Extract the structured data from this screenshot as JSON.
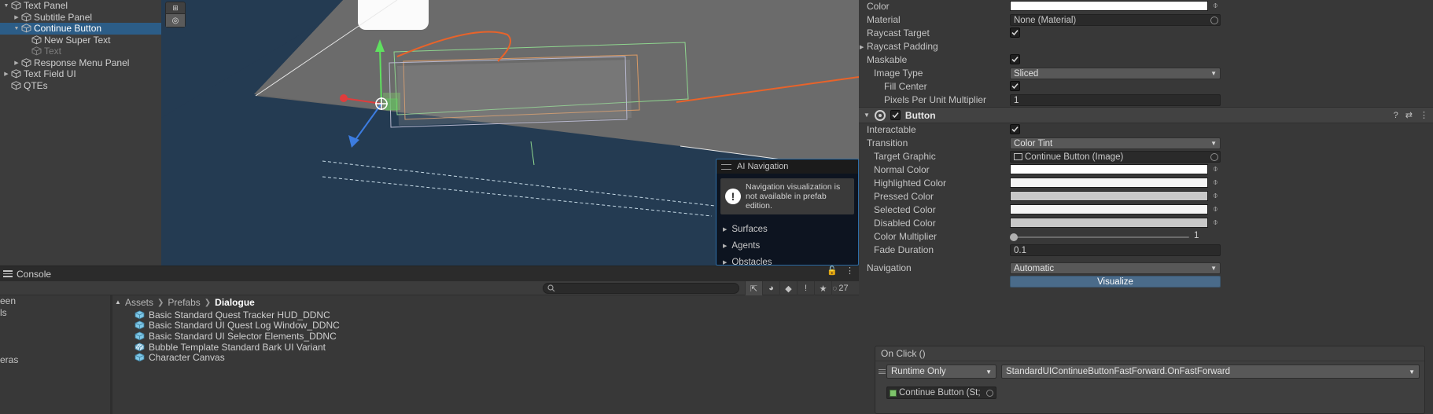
{
  "hierarchy": {
    "items": [
      {
        "label": "Text Panel",
        "indent": 1,
        "arrow": "down",
        "selected": false,
        "dim": false
      },
      {
        "label": "Subtitle Panel",
        "indent": 2,
        "arrow": "right",
        "selected": false,
        "dim": false
      },
      {
        "label": "Continue Button",
        "indent": 2,
        "arrow": "down",
        "selected": true,
        "dim": false
      },
      {
        "label": "New Super Text",
        "indent": 3,
        "arrow": "none",
        "selected": false,
        "dim": false
      },
      {
        "label": "Text",
        "indent": 3,
        "arrow": "none",
        "selected": false,
        "dim": true
      },
      {
        "label": "Response Menu Panel",
        "indent": 2,
        "arrow": "right",
        "selected": false,
        "dim": false
      },
      {
        "label": "Text Field UI",
        "indent": 1,
        "arrow": "right",
        "selected": false,
        "dim": false
      },
      {
        "label": "QTEs",
        "indent": 1,
        "arrow": "none",
        "selected": false,
        "dim": false
      }
    ]
  },
  "scene": {
    "ai_navigation": {
      "title": "AI Navigation",
      "warning": "Navigation visualization is not available in prefab edition.",
      "sections": [
        "Surfaces",
        "Agents",
        "Obstacles"
      ]
    }
  },
  "inspector": {
    "image_component": {
      "rows": [
        {
          "label": "Color",
          "indent": 0,
          "type": "color",
          "value": "#ffffff"
        },
        {
          "label": "Material",
          "indent": 0,
          "type": "object",
          "value": "None (Material)"
        },
        {
          "label": "Raycast Target",
          "indent": 0,
          "type": "checkbox",
          "value": true
        },
        {
          "label": "Raycast Padding",
          "indent": 0,
          "type": "foldout",
          "value": ""
        },
        {
          "label": "Maskable",
          "indent": 0,
          "type": "checkbox",
          "value": true
        },
        {
          "label": "Image Type",
          "indent": 1,
          "type": "dropdown",
          "value": "Sliced"
        },
        {
          "label": "Fill Center",
          "indent": 2,
          "type": "checkbox",
          "value": true
        },
        {
          "label": "Pixels Per Unit Multiplier",
          "indent": 2,
          "type": "number",
          "value": "1"
        }
      ]
    },
    "button_component": {
      "title": "Button",
      "enabled": true,
      "rows": [
        {
          "label": "Interactable",
          "indent": 0,
          "type": "checkbox",
          "value": true
        },
        {
          "label": "Transition",
          "indent": 0,
          "type": "dropdown",
          "value": "Color Tint"
        },
        {
          "label": "Target Graphic",
          "indent": 1,
          "type": "object",
          "value": "Continue Button (Image)"
        },
        {
          "label": "Normal Color",
          "indent": 1,
          "type": "color",
          "value": "#ffffff"
        },
        {
          "label": "Highlighted Color",
          "indent": 1,
          "type": "color",
          "value": "#f5f5f5"
        },
        {
          "label": "Pressed Color",
          "indent": 1,
          "type": "color",
          "value": "#c8c8c8"
        },
        {
          "label": "Selected Color",
          "indent": 1,
          "type": "color",
          "value": "#f5f5f5"
        },
        {
          "label": "Disabled Color",
          "indent": 1,
          "type": "color",
          "value": "#c8c8c8"
        },
        {
          "label": "Color Multiplier",
          "indent": 1,
          "type": "slider",
          "value": "1"
        },
        {
          "label": "Fade Duration",
          "indent": 1,
          "type": "number",
          "value": "0.1"
        },
        {
          "label": "Navigation",
          "indent": 0,
          "type": "dropdown",
          "value": "Automatic"
        },
        {
          "label": "",
          "indent": 0,
          "type": "button",
          "value": "Visualize"
        }
      ]
    },
    "on_click": {
      "title": "On Click ()",
      "entries": [
        {
          "mode": "Runtime Only",
          "function": "StandardUIContinueButtonFastForward.OnFastForward",
          "object": "Continue Button (St;"
        }
      ]
    }
  },
  "console": {
    "tab_label": "Console"
  },
  "project": {
    "search_placeholder": "",
    "visible_count": "27",
    "left_items": [
      "een",
      "ls",
      "",
      "",
      "",
      "eras"
    ],
    "breadcrumb": [
      "Assets",
      "Prefabs",
      "Dialogue"
    ],
    "assets": [
      {
        "name": "Basic Standard Quest Tracker HUD_DDNC",
        "variant": false
      },
      {
        "name": "Basic Standard UI Quest Log Window_DDNC",
        "variant": false
      },
      {
        "name": "Basic Standard UI Selector Elements_DDNC",
        "variant": false
      },
      {
        "name": "Bubble Template Standard Bark UI Variant",
        "variant": true
      },
      {
        "name": "Character Canvas",
        "variant": false
      }
    ]
  },
  "colors": {
    "selection_blue": "#2c5d87",
    "accent_button": "#4a6b8a",
    "scene_bg": "#243b52",
    "panel_bg": "#383838"
  }
}
